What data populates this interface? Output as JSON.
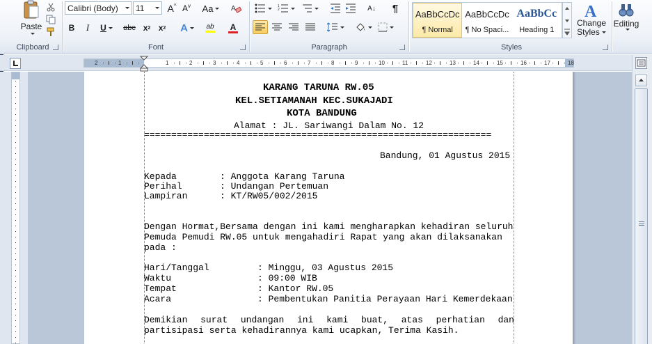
{
  "ribbon": {
    "clipboard": {
      "group_label": "Clipboard",
      "paste_label": "Paste",
      "cut_icon": "scissors-icon",
      "copy_icon": "copy-icon",
      "format_painter_icon": "brush-icon"
    },
    "font": {
      "group_label": "Font",
      "font_name": "Calibri (Body)",
      "font_size": "11",
      "grow_label": "A",
      "shrink_label": "A",
      "change_case_label": "Aa",
      "bold": "B",
      "italic": "I",
      "underline": "U",
      "strike": "abc",
      "subscript": "x",
      "subscript_mark": "2",
      "superscript": "x",
      "superscript_mark": "2",
      "effects_label": "A",
      "highlight_label": "ab",
      "font_color_label": "A",
      "highlight_color": "#ffff00",
      "font_color": "#e02020"
    },
    "paragraph": {
      "group_label": "Paragraph",
      "pilcrow": "¶",
      "sort_label": "A↓"
    },
    "styles": {
      "group_label": "Styles",
      "items": [
        {
          "sample": "AaBbCcDc",
          "name": "¶ Normal",
          "selected": true
        },
        {
          "sample": "AaBbCcDc",
          "name": "¶ No Spaci...",
          "selected": false
        },
        {
          "sample": "AaBbCc",
          "name": "Heading 1",
          "selected": false
        }
      ],
      "change_styles_line1": "Change",
      "change_styles_line2": "Styles"
    },
    "editing": {
      "label": "Editing"
    }
  },
  "ruler": {
    "labels": [
      "2",
      "1",
      "1",
      "2",
      "3",
      "4",
      "5",
      "6",
      "7",
      "8",
      "9",
      "10",
      "11",
      "12",
      "13",
      "14",
      "15",
      "16",
      "17",
      "18"
    ]
  },
  "document": {
    "header_line1": "KARANG TARUNA RW.05",
    "header_line2": "KEL.SETIAMANAH KEC.SUKAJADI",
    "header_line3": "KOTA BANDUNG",
    "address": "Alamat : JL. Sariwangi Dalam No. 12",
    "separator": "================================================================",
    "date_line": "Bandung, 01 Agustus 2015",
    "fields": [
      {
        "label": "Kepada",
        "value": ": Anggota Karang Taruna"
      },
      {
        "label": "Perihal",
        "value": ": Undangan Pertemuan"
      },
      {
        "label": "Lampiran",
        "value": ": KT/RW05/002/2015"
      }
    ],
    "body_line1": "Dengan Hormat,Bersama dengan ini kami mengharapkan kehadiran seluruh",
    "body_line2": "Pemuda Pemudi RW.05 untuk mengahadiri Rapat yang akan dilaksanakan",
    "body_line3": "pada :",
    "event": [
      {
        "label": "Hari/Tanggal",
        "value": ": Minggu, 03 Agustus 2015"
      },
      {
        "label": "Waktu",
        "value": ": 09:00 WIB"
      },
      {
        "label": "Tempat",
        "value": ": Kantor RW.05"
      },
      {
        "label": "Acara",
        "value": ": Pembentukan Panitia Perayaan Hari Kemerdekaan"
      }
    ],
    "closing_line1": "Demikian surat undangan ini kami buat, atas perhatian dan",
    "closing_line2": "partisipasi serta kehadirannya kami ucapkan, Terima Kasih."
  }
}
